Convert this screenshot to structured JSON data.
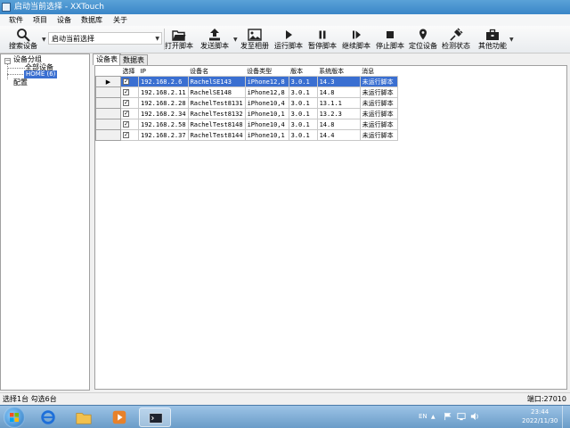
{
  "window": {
    "title": "启动当前选择 - XXTouch"
  },
  "menu": [
    "软件",
    "项目",
    "设备",
    "数据库",
    "关于"
  ],
  "toolbar": {
    "search_label": "搜索设备",
    "script_combo_value": "启动当前选择",
    "buttons": [
      {
        "label": "打开脚本",
        "icon": "folder-open-icon"
      },
      {
        "label": "发送脚本",
        "icon": "upload-icon"
      },
      {
        "label": "发至相册",
        "icon": "image-icon"
      },
      {
        "label": "运行脚本",
        "icon": "play-icon"
      },
      {
        "label": "暂停脚本",
        "icon": "pause-icon"
      },
      {
        "label": "继续脚本",
        "icon": "resume-icon"
      },
      {
        "label": "停止脚本",
        "icon": "stop-icon"
      },
      {
        "label": "定位设备",
        "icon": "map-pin-icon"
      },
      {
        "label": "检测状态",
        "icon": "plug-icon"
      },
      {
        "label": "其他功能",
        "icon": "toolbox-icon"
      }
    ]
  },
  "tree": {
    "root": "设备分组",
    "children": [
      "全部设备",
      "HOME (6)"
    ],
    "config": "配置"
  },
  "tabs": [
    "设备表",
    "数据表"
  ],
  "grid": {
    "columns": [
      "选择",
      "IP",
      "设备名",
      "设备类型",
      "版本",
      "系统版本",
      "消息"
    ],
    "rows": [
      {
        "ip": "192.168.2.6",
        "name": "RachelSE143",
        "type": "iPhone12,8",
        "version": "3.0.1",
        "os": "14.3",
        "msg": "未运行脚本",
        "checked": true,
        "selected": true
      },
      {
        "ip": "192.168.2.11",
        "name": "RachelSE148",
        "type": "iPhone12,8",
        "version": "3.0.1",
        "os": "14.8",
        "msg": "未运行脚本",
        "checked": true,
        "selected": false
      },
      {
        "ip": "192.168.2.28",
        "name": "RachelTest8131",
        "type": "iPhone10,4",
        "version": "3.0.1",
        "os": "13.1.1",
        "msg": "未运行脚本",
        "checked": true,
        "selected": false
      },
      {
        "ip": "192.168.2.34",
        "name": "RachelTest8132",
        "type": "iPhone10,1",
        "version": "3.0.1",
        "os": "13.2.3",
        "msg": "未运行脚本",
        "checked": true,
        "selected": false
      },
      {
        "ip": "192.168.2.58",
        "name": "RachelTest8148",
        "type": "iPhone10,4",
        "version": "3.0.1",
        "os": "14.8",
        "msg": "未运行脚本",
        "checked": true,
        "selected": false
      },
      {
        "ip": "192.168.2.37",
        "name": "RachelTest8144",
        "type": "iPhone10,1",
        "version": "3.0.1",
        "os": "14.4",
        "msg": "未运行脚本",
        "checked": true,
        "selected": false
      }
    ]
  },
  "status": {
    "left": "选择1台  勾选6台",
    "right": "端口:27010"
  },
  "taskbar": {
    "lang": "EN",
    "time": "23:44",
    "date": "2022/11/30"
  },
  "colors": {
    "selection": "#3a6fd1",
    "titlebar": "#3a86c8"
  }
}
